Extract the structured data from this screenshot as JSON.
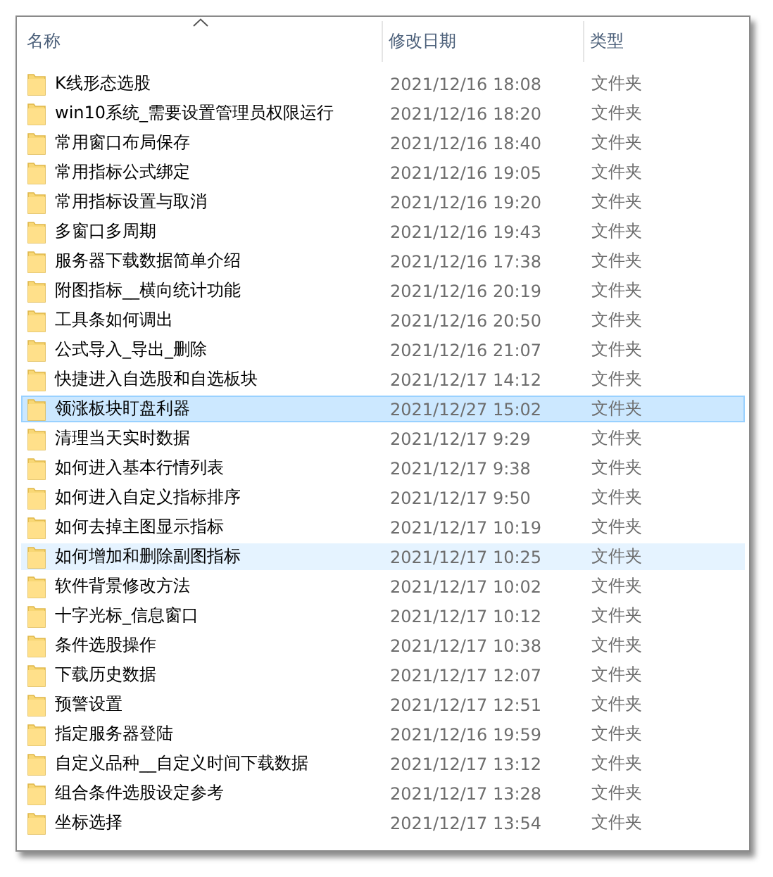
{
  "columns": [
    {
      "label": "名称",
      "sorted": true
    },
    {
      "label": "修改日期",
      "sorted": false
    },
    {
      "label": "类型",
      "sorted": false
    }
  ],
  "rows": [
    {
      "name": "K线形态选股",
      "modified": "2021/12/16 18:08",
      "type": "文件夹",
      "selected": false,
      "hovered": false
    },
    {
      "name": "win10系统_需要设置管理员权限运行",
      "modified": "2021/12/16 18:20",
      "type": "文件夹",
      "selected": false,
      "hovered": false
    },
    {
      "name": "常用窗口布局保存",
      "modified": "2021/12/16 18:40",
      "type": "文件夹",
      "selected": false,
      "hovered": false
    },
    {
      "name": "常用指标公式绑定",
      "modified": "2021/12/16 19:05",
      "type": "文件夹",
      "selected": false,
      "hovered": false
    },
    {
      "name": "常用指标设置与取消",
      "modified": "2021/12/16 19:20",
      "type": "文件夹",
      "selected": false,
      "hovered": false
    },
    {
      "name": "多窗口多周期",
      "modified": "2021/12/16 19:43",
      "type": "文件夹",
      "selected": false,
      "hovered": false
    },
    {
      "name": "服务器下载数据简单介绍",
      "modified": "2021/12/16 17:38",
      "type": "文件夹",
      "selected": false,
      "hovered": false
    },
    {
      "name": "附图指标__横向统计功能",
      "modified": "2021/12/16 20:19",
      "type": "文件夹",
      "selected": false,
      "hovered": false
    },
    {
      "name": "工具条如何调出",
      "modified": "2021/12/16 20:50",
      "type": "文件夹",
      "selected": false,
      "hovered": false
    },
    {
      "name": "公式导入_导出_删除",
      "modified": "2021/12/16 21:07",
      "type": "文件夹",
      "selected": false,
      "hovered": false
    },
    {
      "name": "快捷进入自选股和自选板块",
      "modified": "2021/12/17 14:12",
      "type": "文件夹",
      "selected": false,
      "hovered": false
    },
    {
      "name": "领涨板块盯盘利器",
      "modified": "2021/12/27 15:02",
      "type": "文件夹",
      "selected": true,
      "hovered": false
    },
    {
      "name": "清理当天实时数据",
      "modified": "2021/12/17 9:29",
      "type": "文件夹",
      "selected": false,
      "hovered": false
    },
    {
      "name": "如何进入基本行情列表",
      "modified": "2021/12/17 9:38",
      "type": "文件夹",
      "selected": false,
      "hovered": false
    },
    {
      "name": "如何进入自定义指标排序",
      "modified": "2021/12/17 9:50",
      "type": "文件夹",
      "selected": false,
      "hovered": false
    },
    {
      "name": "如何去掉主图显示指标",
      "modified": "2021/12/17 10:19",
      "type": "文件夹",
      "selected": false,
      "hovered": false
    },
    {
      "name": "如何增加和删除副图指标",
      "modified": "2021/12/17 10:25",
      "type": "文件夹",
      "selected": false,
      "hovered": true
    },
    {
      "name": "软件背景修改方法",
      "modified": "2021/12/17 10:02",
      "type": "文件夹",
      "selected": false,
      "hovered": false
    },
    {
      "name": "十字光标_信息窗口",
      "modified": "2021/12/17 10:12",
      "type": "文件夹",
      "selected": false,
      "hovered": false
    },
    {
      "name": "条件选股操作",
      "modified": "2021/12/17 10:38",
      "type": "文件夹",
      "selected": false,
      "hovered": false
    },
    {
      "name": "下载历史数据",
      "modified": "2021/12/17 12:07",
      "type": "文件夹",
      "selected": false,
      "hovered": false
    },
    {
      "name": "预警设置",
      "modified": "2021/12/17 12:51",
      "type": "文件夹",
      "selected": false,
      "hovered": false
    },
    {
      "name": "指定服务器登陆",
      "modified": "2021/12/16 19:59",
      "type": "文件夹",
      "selected": false,
      "hovered": false
    },
    {
      "name": "自定义品种__自定义时间下载数据",
      "modified": "2021/12/17 13:12",
      "type": "文件夹",
      "selected": false,
      "hovered": false
    },
    {
      "name": "组合条件选股设定参考",
      "modified": "2021/12/17 13:28",
      "type": "文件夹",
      "selected": false,
      "hovered": false
    },
    {
      "name": "坐标选择",
      "modified": "2021/12/17 13:54",
      "type": "文件夹",
      "selected": false,
      "hovered": false
    }
  ]
}
